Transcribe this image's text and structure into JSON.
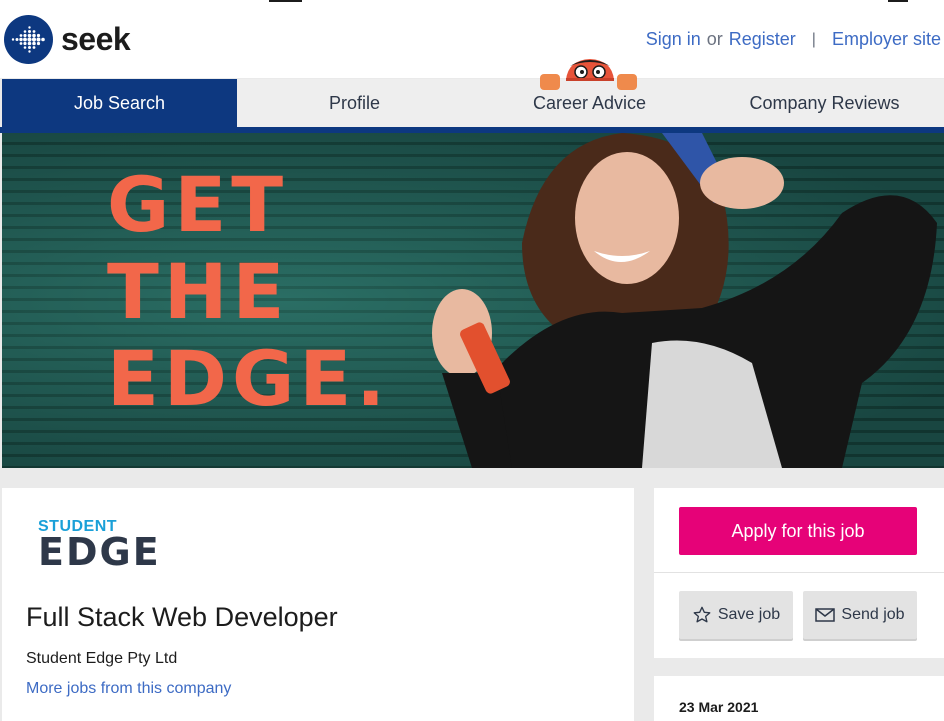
{
  "header": {
    "logo_text": "seek",
    "sign_in": "Sign in",
    "or": "or",
    "register": "Register",
    "separator": "|",
    "employer_site": "Employer site"
  },
  "nav": {
    "tabs": [
      {
        "label": "Job Search",
        "active": true
      },
      {
        "label": "Profile",
        "active": false
      },
      {
        "label": "Career Advice",
        "active": false
      },
      {
        "label": "Company Reviews",
        "active": false
      }
    ]
  },
  "banner": {
    "headline_lines": [
      "GET",
      "THE",
      "EDGE."
    ]
  },
  "job": {
    "brand_logo_top": "STUDENT",
    "brand_logo_bottom": "EDGE",
    "title": "Full Stack Web Developer",
    "company": "Student Edge Pty Ltd",
    "more_jobs": "More jobs from this company"
  },
  "actions": {
    "apply": "Apply for this job",
    "save": "Save job",
    "send": "Send job"
  },
  "meta": {
    "date": "23 Mar 2021"
  },
  "colors": {
    "brand_navy": "#0d3880",
    "apply_pink": "#e60278",
    "link_blue": "#3d6bc4",
    "headline_orange": "#f2674a"
  }
}
